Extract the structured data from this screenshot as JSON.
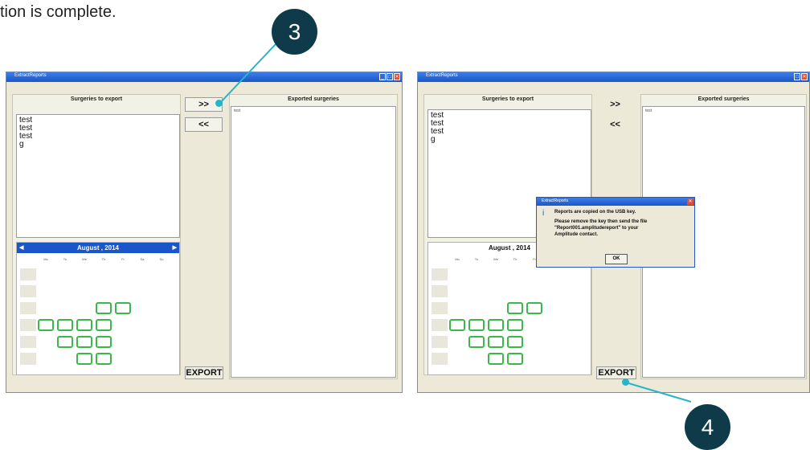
{
  "caption": "tion is complete.",
  "callouts": [
    "3",
    "4"
  ],
  "window": {
    "title": "ExtractReports",
    "ctrl_min": "_",
    "ctrl_max": "□",
    "ctrl_close": "✕"
  },
  "left_panel": {
    "header": "Surgeries to export",
    "items": [
      "test",
      "test",
      "test",
      "g"
    ]
  },
  "right_panel": {
    "header": "Exported surgeries",
    "item": "test"
  },
  "buttons": {
    "add": ">>",
    "remove": "<<",
    "export": "EXPORT"
  },
  "calendar": {
    "month_label": "August , 2014",
    "prev": "◀",
    "next": "▶",
    "weekdays": [
      "Mo",
      "Tu",
      "We",
      "Th",
      "Fr",
      "Sa",
      "Su"
    ]
  },
  "dialog": {
    "title": "ExtractReports",
    "close": "✕",
    "icon": "i",
    "line1": "Reports are copied on the USB key.",
    "line2": "Please remove the key then send the file",
    "line3": "\"Report001.amplitudereport\" to your",
    "line4": "Amplitude contact.",
    "ok": "OK"
  },
  "colors": {
    "callout": "#0e3a4a",
    "callout_line": "#26b5c8",
    "selected_day": "#3cb84a",
    "titlebar": "#1a56c9"
  }
}
